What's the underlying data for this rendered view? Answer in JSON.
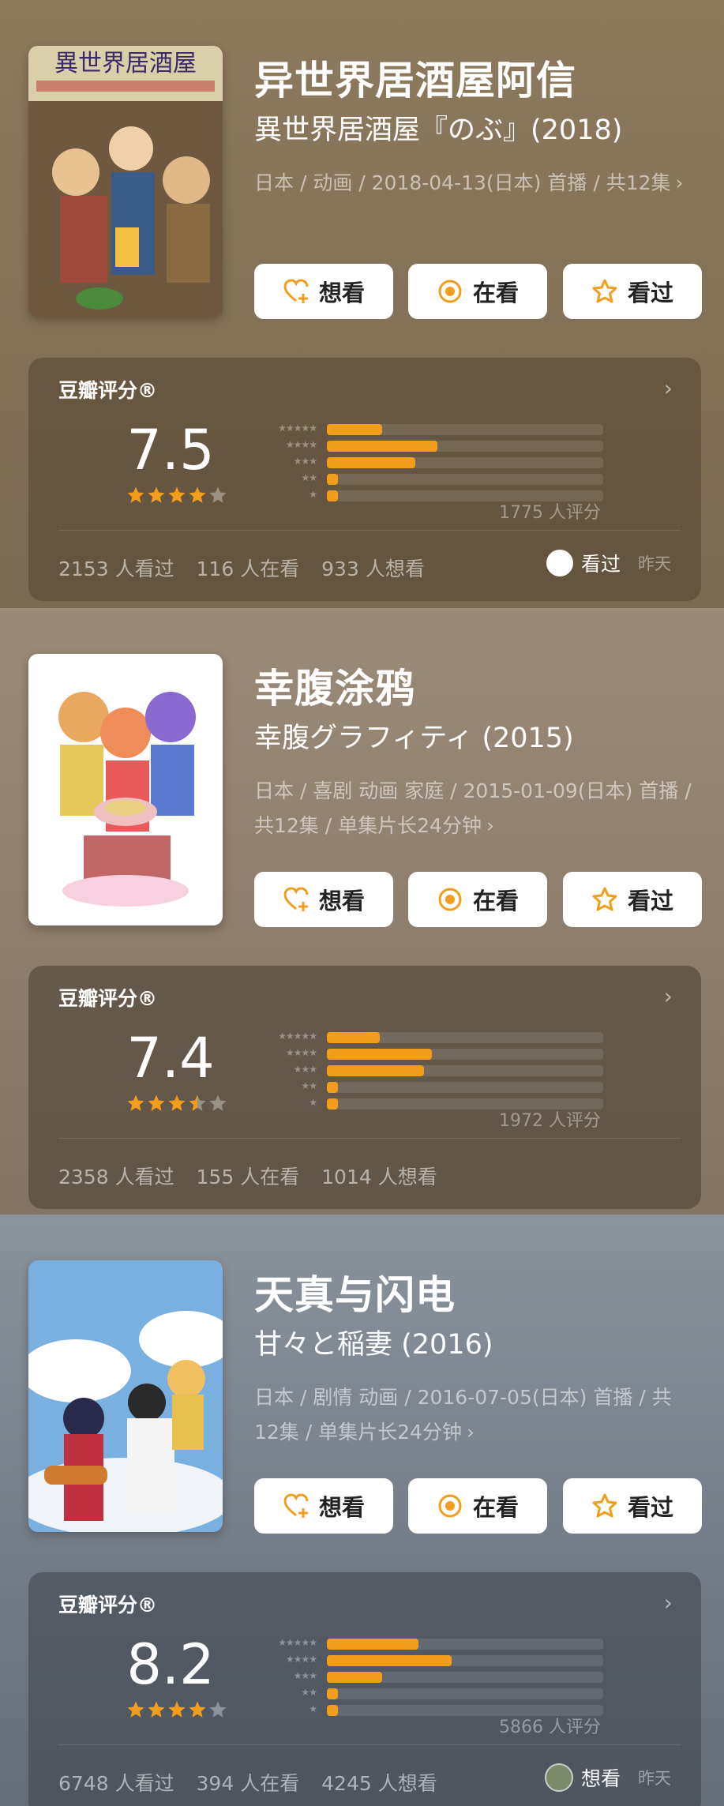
{
  "items": [
    {
      "title": "异世界居酒屋阿信",
      "subtitle": "異世界居酒屋『のぶ』(2018)",
      "meta": "日本 / 动画 / 2018-04-13(日本) 首播 / 共12集",
      "poster_text": "異世界居酒屋",
      "buttons": {
        "want": "想看",
        "watching": "在看",
        "watched": "看过"
      },
      "rating": {
        "label": "豆瓣评分®",
        "score": "7.5",
        "stars": 4,
        "distribution": [
          0.2,
          0.4,
          0.32,
          0.04,
          0.03
        ],
        "count_text": "1775 人评分"
      },
      "stats": [
        "2153 人看过",
        "116 人在看",
        "933 人想看"
      ],
      "status": {
        "label": "看过",
        "date": "昨天",
        "icon": "circle-icon"
      }
    },
    {
      "title": "幸腹涂鸦",
      "subtitle": "幸腹グラフィティ (2015)",
      "meta": "日本 / 喜剧 动画 家庭 / 2015-01-09(日本) 首播 / 共12集 / 单集片长24分钟",
      "buttons": {
        "want": "想看",
        "watching": "在看",
        "watched": "看过"
      },
      "rating": {
        "label": "豆瓣评分®",
        "score": "7.4",
        "stars": 3.5,
        "distribution": [
          0.19,
          0.38,
          0.35,
          0.04,
          0.03
        ],
        "count_text": "1972 人评分"
      },
      "stats": [
        "2358 人看过",
        "155 人在看",
        "1014 人想看"
      ]
    },
    {
      "title": "天真与闪电",
      "subtitle": "甘々と稲妻 (2016)",
      "meta": "日本 / 剧情 动画 / 2016-07-05(日本) 首播 / 共12集 / 单集片长24分钟",
      "buttons": {
        "want": "想看",
        "watching": "在看",
        "watched": "看过"
      },
      "rating": {
        "label": "豆瓣评分®",
        "score": "8.2",
        "stars": 4,
        "distribution": [
          0.33,
          0.45,
          0.2,
          0.03,
          0.03
        ],
        "count_text": "5866 人评分"
      },
      "stats": [
        "6748 人看过",
        "394 人在看",
        "4245 人想看"
      ],
      "status": {
        "label": "想看",
        "date": "昨天",
        "icon": "avatar-icon"
      }
    }
  ],
  "colors": {
    "accent": "#f29d1c",
    "section1_bg": "#8e7a5e",
    "section2_bg": "#8a7a68",
    "section3_bg": "#6a7480"
  }
}
